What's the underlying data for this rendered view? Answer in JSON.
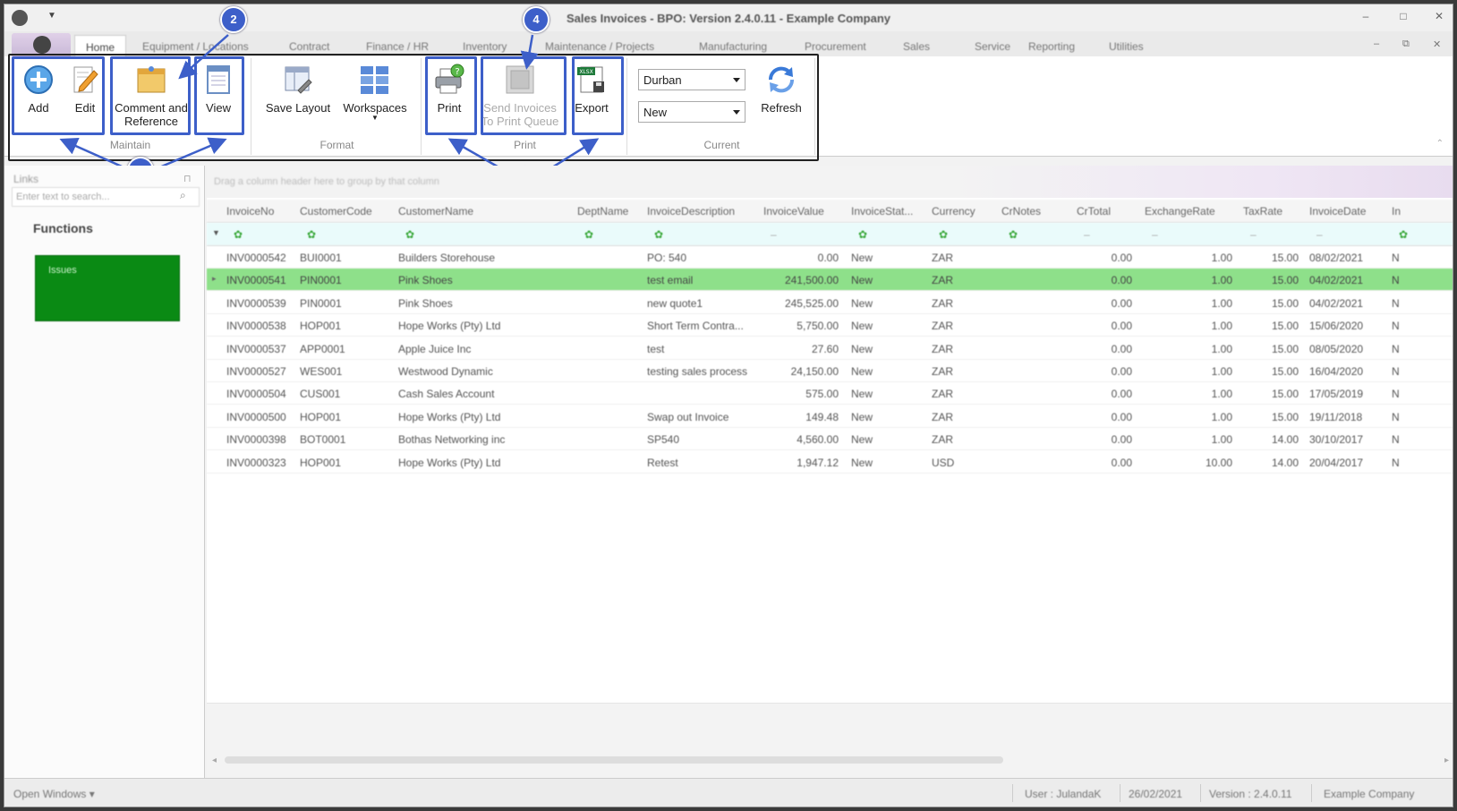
{
  "window": {
    "title": "Sales Invoices - BPO: Version 2.4.0.11 - Example Company"
  },
  "tabs": [
    "Home",
    "Equipment / Locations",
    "Contract",
    "Finance / HR",
    "Inventory",
    "Maintenance / Projects",
    "Manufacturing",
    "Procurement",
    "Sales",
    "Service",
    "Reporting",
    "Utilities"
  ],
  "ribbon": {
    "maintain": {
      "label": "Maintain",
      "add": "Add",
      "edit": "Edit",
      "comment_line1": "Comment and",
      "comment_line2": "Reference",
      "view": "View"
    },
    "format": {
      "label": "Format",
      "save_layout": "Save Layout",
      "workspaces": "Workspaces"
    },
    "print": {
      "label": "Print",
      "print": "Print",
      "send_line1": "Send Invoices",
      "send_line2": "To Print Queue",
      "export": "Export",
      "export_badge": "XLSX"
    },
    "current": {
      "label": "Current",
      "site": "Durban",
      "status": "New",
      "refresh": "Refresh"
    }
  },
  "callouts": [
    "1",
    "2",
    "3",
    "4"
  ],
  "links": {
    "header": "Links",
    "search_placeholder": "Enter text to search...",
    "functions_title": "Functions",
    "tile": "Issues"
  },
  "grid": {
    "group_hint": "Drag a column header here to group by that column",
    "columns": [
      "InvoiceNo",
      "CustomerCode",
      "CustomerName",
      "DeptName",
      "InvoiceDescription",
      "InvoiceValue",
      "InvoiceStat...",
      "Currency",
      "CrNotes",
      "CrTotal",
      "ExchangeRate",
      "TaxRate",
      "InvoiceDate",
      "In"
    ],
    "rows": [
      [
        "INV0000542",
        "BUI0001",
        "Builders Storehouse",
        "",
        "PO: 540",
        "0.00",
        "New",
        "ZAR",
        "",
        "0.00",
        "1.00",
        "15.00",
        "08/02/2021",
        "N"
      ],
      [
        "INV0000541",
        "PIN0001",
        "Pink Shoes",
        "",
        "test email",
        "241,500.00",
        "New",
        "ZAR",
        "",
        "0.00",
        "1.00",
        "15.00",
        "04/02/2021",
        "N"
      ],
      [
        "INV0000539",
        "PIN0001",
        "Pink Shoes",
        "",
        "new quote1",
        "245,525.00",
        "New",
        "ZAR",
        "",
        "0.00",
        "1.00",
        "15.00",
        "04/02/2021",
        "N"
      ],
      [
        "INV0000538",
        "HOP001",
        "Hope Works (Pty) Ltd",
        "",
        "Short Term Contra...",
        "5,750.00",
        "New",
        "ZAR",
        "",
        "0.00",
        "1.00",
        "15.00",
        "15/06/2020",
        "N"
      ],
      [
        "INV0000537",
        "APP0001",
        "Apple Juice Inc",
        "",
        "test",
        "27.60",
        "New",
        "ZAR",
        "",
        "0.00",
        "1.00",
        "15.00",
        "08/05/2020",
        "N"
      ],
      [
        "INV0000527",
        "WES001",
        "Westwood Dynamic",
        "",
        "testing sales process",
        "24,150.00",
        "New",
        "ZAR",
        "",
        "0.00",
        "1.00",
        "15.00",
        "16/04/2020",
        "N"
      ],
      [
        "INV0000504",
        "CUS001",
        "Cash Sales Account",
        "",
        "",
        "575.00",
        "New",
        "ZAR",
        "",
        "0.00",
        "1.00",
        "15.00",
        "17/05/2019",
        "N"
      ],
      [
        "INV0000500",
        "HOP001",
        "Hope Works (Pty) Ltd",
        "",
        "Swap out Invoice",
        "149.48",
        "New",
        "ZAR",
        "",
        "0.00",
        "1.00",
        "15.00",
        "19/11/2018",
        "N"
      ],
      [
        "INV0000398",
        "BOT0001",
        "Bothas Networking inc",
        "",
        "SP540",
        "4,560.00",
        "New",
        "ZAR",
        "",
        "0.00",
        "1.00",
        "14.00",
        "30/10/2017",
        "N"
      ],
      [
        "INV0000323",
        "HOP001",
        "Hope Works (Pty) Ltd",
        "",
        "Retest",
        "1,947.12",
        "New",
        "USD",
        "",
        "0.00",
        "10.00",
        "14.00",
        "20/04/2017",
        "N"
      ]
    ],
    "selected_row": 1
  },
  "statusbar": {
    "open_windows": "Open Windows",
    "user": "User : JulandaK",
    "date": "26/02/2021",
    "version": "Version : 2.4.0.11",
    "company": "Example Company"
  },
  "colors": {
    "accent": "#3d5fc9",
    "selected_row": "#8ee08a",
    "tile": "#0a8a14"
  }
}
